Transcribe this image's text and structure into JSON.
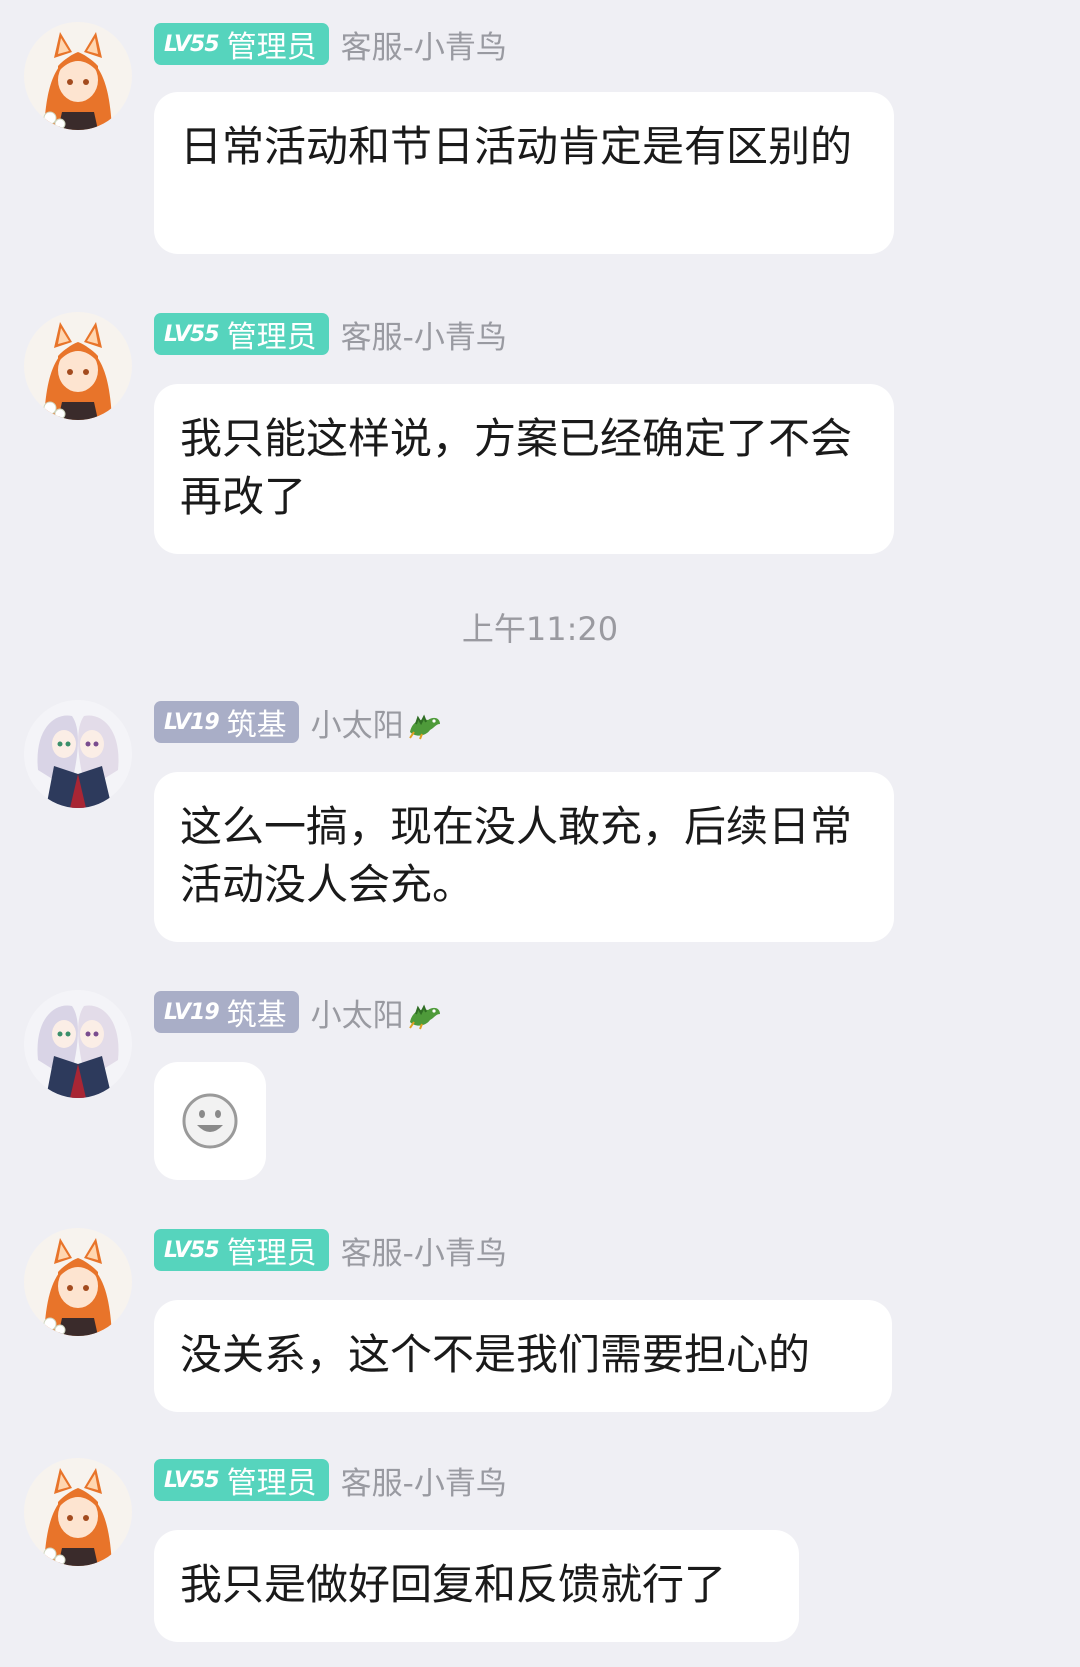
{
  "timestamp": "上午11:20",
  "messages": [
    {
      "level": "LV55",
      "title": "管理员",
      "name": "客服-小青鸟",
      "text": "日常活动和节日活动肯定是有区别的"
    },
    {
      "level": "LV55",
      "title": "管理员",
      "name": "客服-小青鸟",
      "text": "我只能这样说，方案已经确定了不会再改了"
    },
    {
      "level": "LV19",
      "title": "筑基",
      "name": "小太阳",
      "text": "这么一搞，现在没人敢充，后续日常活动没人会充。"
    },
    {
      "level": "LV19",
      "title": "筑基",
      "name": "小太阳",
      "emoji": "smile-emoji"
    },
    {
      "level": "LV55",
      "title": "管理员",
      "name": "客服-小青鸟",
      "text": "没关系，这个不是我们需要担心的"
    },
    {
      "level": "LV55",
      "title": "管理员",
      "name": "客服-小青鸟",
      "text": "我只是做好回复和反馈就行了"
    }
  ],
  "colors": {
    "background": "#efeff4",
    "admin_badge": "#56d4bd",
    "member_badge": "#a9aec7",
    "bubble": "#ffffff"
  }
}
